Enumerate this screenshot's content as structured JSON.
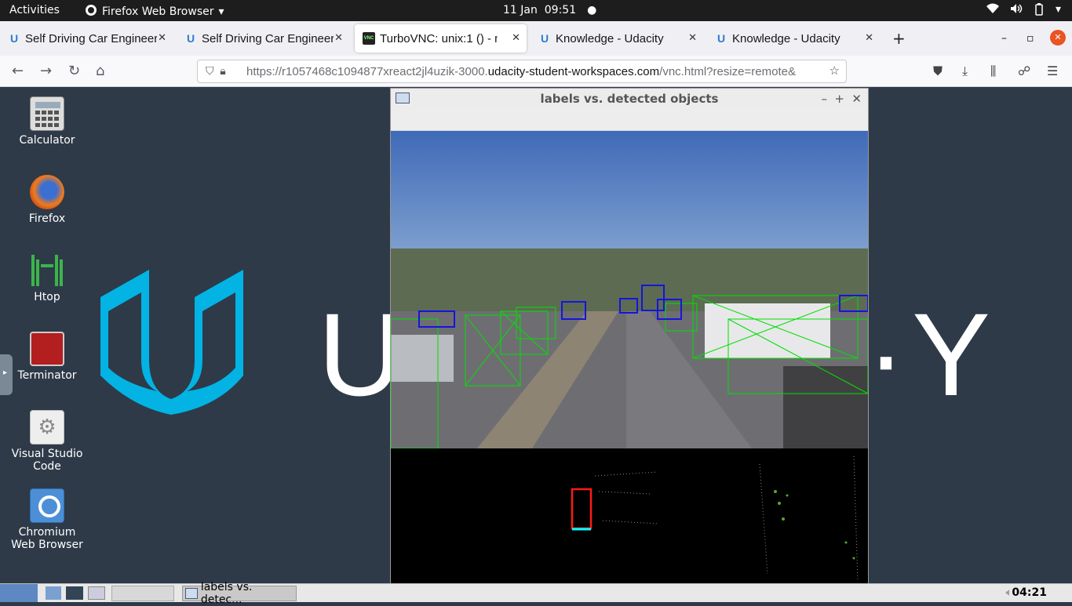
{
  "topbar": {
    "activities": "Activities",
    "app_menu": "Firefox Web Browser",
    "date": "11 Jan",
    "time": "09:51"
  },
  "tabs": [
    {
      "title": "Self Driving Car Engineer",
      "icon": "udacity-icon"
    },
    {
      "title": "Self Driving Car Engineer",
      "icon": "udacity-icon"
    },
    {
      "title": "TurboVNC: unix:1 () - noVNC",
      "icon": "vnc-icon",
      "active": true
    },
    {
      "title": "Knowledge - Udacity",
      "icon": "udacity-icon"
    },
    {
      "title": "Knowledge - Udacity",
      "icon": "udacity-icon"
    }
  ],
  "urlbar": {
    "prefix": "https://r1057468c1094877xreact2jl4uzik-3000.",
    "domain": "udacity-student-workspaces.com",
    "suffix": "/vnc.html?resize=remote&"
  },
  "desktop_icons": [
    {
      "label": "Calculator",
      "icon": "calculator-icon"
    },
    {
      "label": "Firefox",
      "icon": "firefox-icon"
    },
    {
      "label": "Htop",
      "icon": "htop-icon"
    },
    {
      "label": "Terminator",
      "icon": "terminator-icon"
    },
    {
      "label": "Visual Studio Code",
      "icon": "vscode-icon"
    },
    {
      "label": "Chromium Web Browser",
      "icon": "chromium-icon"
    }
  ],
  "logo": {
    "brand_color": "#02b3e4"
  },
  "vnc_window": {
    "title": "labels vs. detected objects"
  },
  "taskbar": {
    "task_label": "labels vs. detec...",
    "clock": "04:21"
  }
}
